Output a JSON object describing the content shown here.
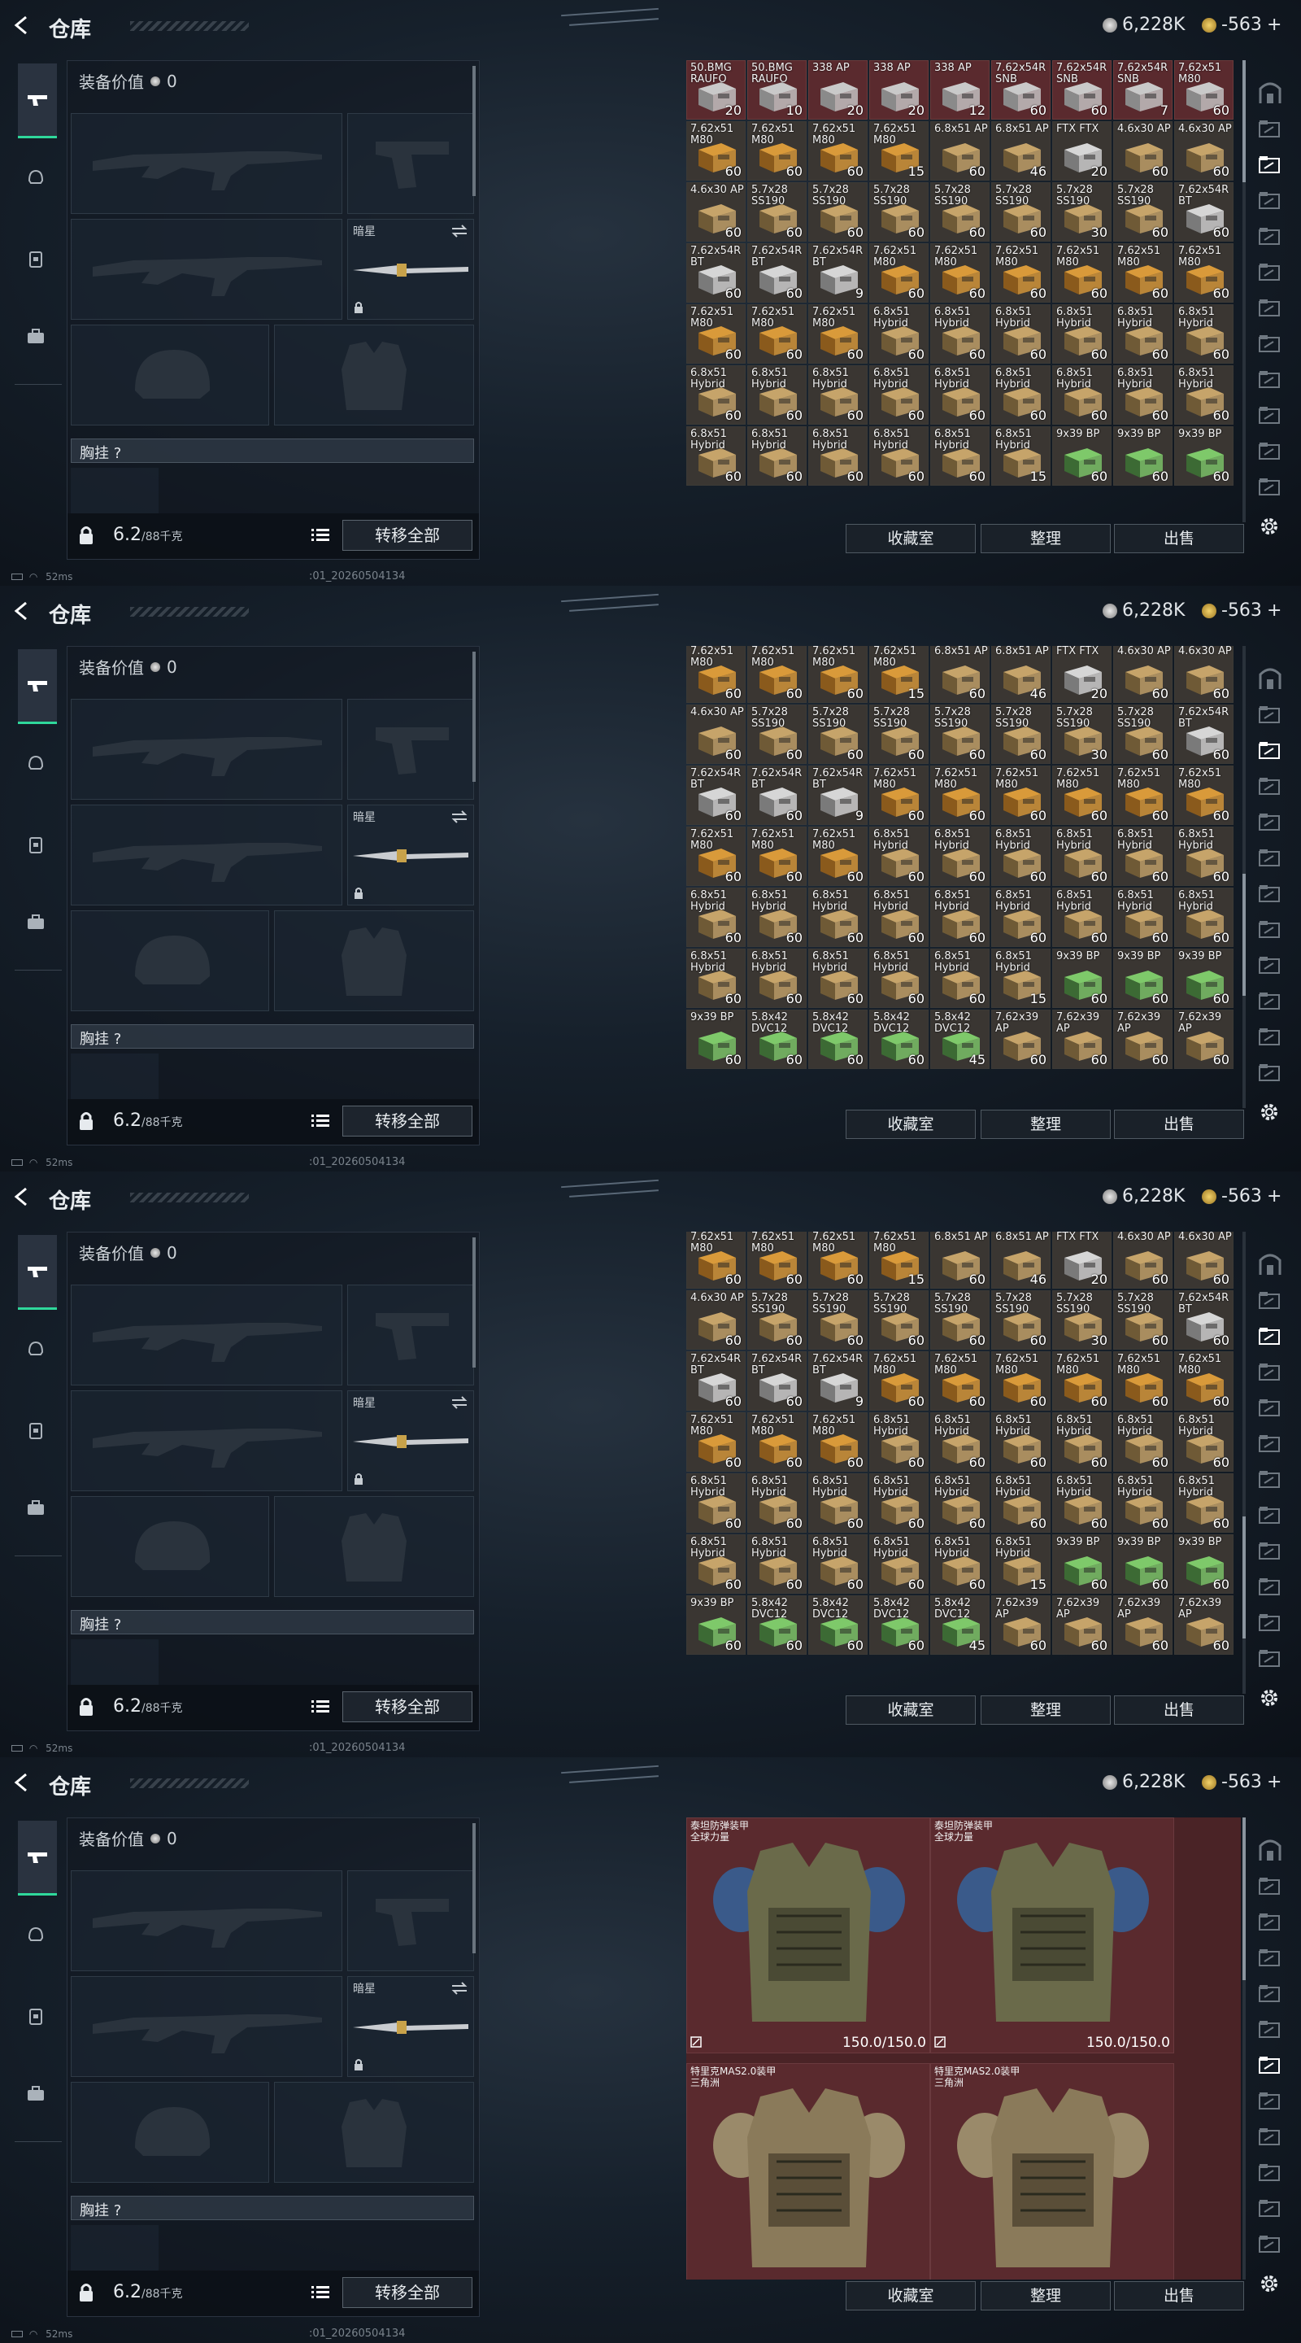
{
  "header": {
    "title": "仓库",
    "currency_a": "6,228K",
    "currency_b": "-563",
    "currency_b_plus": "+"
  },
  "equip": {
    "value_label": "装备价值",
    "value": "0",
    "melee_name": "暗星",
    "chest_label": "胸挂 ?",
    "weight": "6.2",
    "weight_max": "/88千克",
    "transfer_label": "转移全部"
  },
  "status": {
    "ping": "52ms",
    "timestamp": ":01_20260504134"
  },
  "actions": {
    "vault": "收藏室",
    "sort": "整理",
    "sell": "出售"
  },
  "colors": {
    "accent": "#2fd89b",
    "highlight_cell": "#5a2a2e",
    "cell_bg": "#3a3632"
  },
  "ammo_rows": [
    [
      [
        "50.BMG RAUFO",
        "20",
        "r"
      ],
      [
        "50.BMG RAUFO",
        "10",
        "r"
      ],
      [
        "338 AP",
        "20",
        "r"
      ],
      [
        "338 AP",
        "20",
        "r"
      ],
      [
        "338 AP",
        "12",
        "r"
      ],
      [
        "7.62x54R SNB",
        "60",
        "r"
      ],
      [
        "7.62x54R SNB",
        "60",
        "r"
      ],
      [
        "7.62x54R SNB",
        "7",
        "r"
      ],
      [
        "7.62x51 M80",
        "60",
        "r"
      ]
    ],
    [
      [
        "7.62x51 M80",
        "60",
        "y"
      ],
      [
        "7.62x51 M80",
        "60",
        "y"
      ],
      [
        "7.62x51 M80",
        "60",
        "y"
      ],
      [
        "7.62x51 M80",
        "15",
        "y"
      ],
      [
        "6.8x51 AP",
        "60",
        "t"
      ],
      [
        "6.8x51 AP",
        "46",
        "t"
      ],
      [
        "FTX FTX",
        "20",
        "w"
      ],
      [
        "4.6x30 AP",
        "60",
        "t"
      ],
      [
        "4.6x30 AP",
        "60",
        "t"
      ]
    ],
    [
      [
        "4.6x30 AP",
        "60",
        "t"
      ],
      [
        "5.7x28 SS190",
        "60",
        "t"
      ],
      [
        "5.7x28 SS190",
        "60",
        "t"
      ],
      [
        "5.7x28 SS190",
        "60",
        "t"
      ],
      [
        "5.7x28 SS190",
        "60",
        "t"
      ],
      [
        "5.7x28 SS190",
        "60",
        "t"
      ],
      [
        "5.7x28 SS190",
        "30",
        "t"
      ],
      [
        "5.7x28 SS190",
        "60",
        "t"
      ],
      [
        "7.62x54R BT",
        "60",
        "w"
      ]
    ],
    [
      [
        "7.62x54R BT",
        "60",
        "w"
      ],
      [
        "7.62x54R BT",
        "60",
        "w"
      ],
      [
        "7.62x54R BT",
        "9",
        "w"
      ],
      [
        "7.62x51 M80",
        "60",
        "y"
      ],
      [
        "7.62x51 M80",
        "60",
        "y"
      ],
      [
        "7.62x51 M80",
        "60",
        "y"
      ],
      [
        "7.62x51 M80",
        "60",
        "y"
      ],
      [
        "7.62x51 M80",
        "60",
        "y"
      ],
      [
        "7.62x51 M80",
        "60",
        "y"
      ]
    ],
    [
      [
        "7.62x51 M80",
        "60",
        "y"
      ],
      [
        "7.62x51 M80",
        "60",
        "y"
      ],
      [
        "7.62x51 M80",
        "60",
        "y"
      ],
      [
        "6.8x51 Hybrid",
        "60",
        "t"
      ],
      [
        "6.8x51 Hybrid",
        "60",
        "t"
      ],
      [
        "6.8x51 Hybrid",
        "60",
        "t"
      ],
      [
        "6.8x51 Hybrid",
        "60",
        "t"
      ],
      [
        "6.8x51 Hybrid",
        "60",
        "t"
      ],
      [
        "6.8x51 Hybrid",
        "60",
        "t"
      ]
    ],
    [
      [
        "6.8x51 Hybrid",
        "60",
        "t"
      ],
      [
        "6.8x51 Hybrid",
        "60",
        "t"
      ],
      [
        "6.8x51 Hybrid",
        "60",
        "t"
      ],
      [
        "6.8x51 Hybrid",
        "60",
        "t"
      ],
      [
        "6.8x51 Hybrid",
        "60",
        "t"
      ],
      [
        "6.8x51 Hybrid",
        "60",
        "t"
      ],
      [
        "6.8x51 Hybrid",
        "60",
        "t"
      ],
      [
        "6.8x51 Hybrid",
        "60",
        "t"
      ],
      [
        "6.8x51 Hybrid",
        "60",
        "t"
      ]
    ],
    [
      [
        "6.8x51 Hybrid",
        "60",
        "t"
      ],
      [
        "6.8x51 Hybrid",
        "60",
        "t"
      ],
      [
        "6.8x51 Hybrid",
        "60",
        "t"
      ],
      [
        "6.8x51 Hybrid",
        "60",
        "t"
      ],
      [
        "6.8x51 Hybrid",
        "60",
        "t"
      ],
      [
        "6.8x51 Hybrid",
        "15",
        "t"
      ],
      [
        "9x39 BP",
        "60",
        "g"
      ],
      [
        "9x39 BP",
        "60",
        "g"
      ],
      [
        "9x39 BP",
        "60",
        "g"
      ]
    ],
    [
      [
        "9x39 BP",
        "60",
        "g"
      ],
      [
        "5.8x42 DVC12",
        "60",
        "g"
      ],
      [
        "5.8x42 DVC12",
        "60",
        "g"
      ],
      [
        "5.8x42 DVC12",
        "60",
        "g"
      ],
      [
        "5.8x42 DVC12",
        "45",
        "g"
      ],
      [
        "7.62x39 AP",
        "60",
        "t"
      ],
      [
        "7.62x39 AP",
        "60",
        "t"
      ],
      [
        "7.62x39 AP",
        "60",
        "t"
      ],
      [
        "7.62x39 AP",
        "60",
        "t"
      ]
    ]
  ],
  "armor": [
    {
      "name": "泰坦防弹装甲\n全球力量",
      "durability": "150.0/150.0"
    },
    {
      "name": "泰坦防弹装甲\n全球力量",
      "durability": "150.0/150.0"
    },
    {
      "name": "特里克MAS2.0装甲\n三角洲",
      "durability": ""
    },
    {
      "name": "特里克MAS2.0装甲\n三角洲",
      "durability": ""
    }
  ]
}
